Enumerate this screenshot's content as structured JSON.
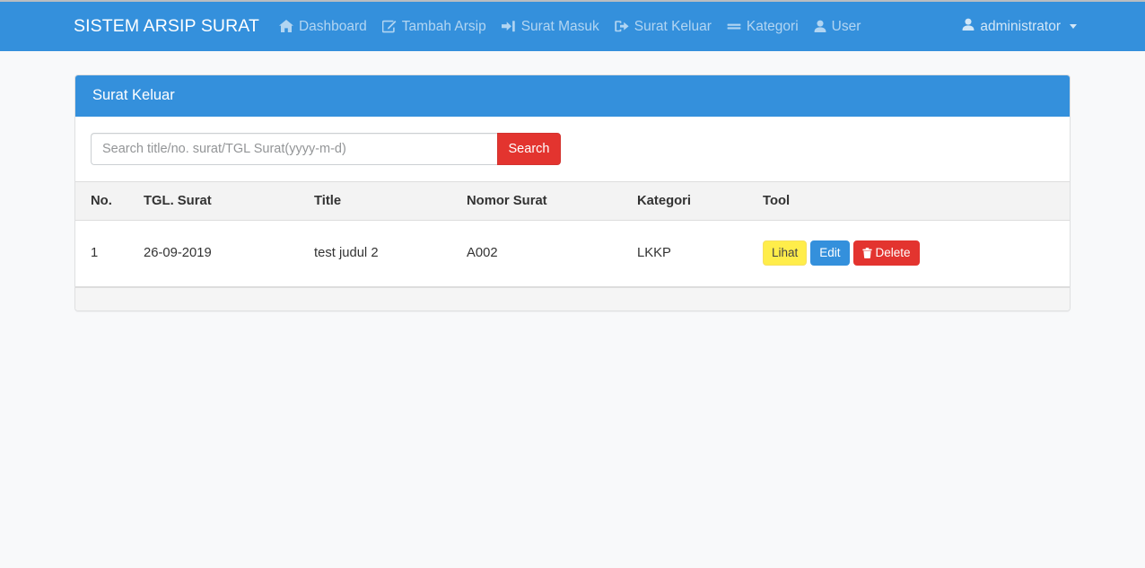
{
  "navbar": {
    "brand": "SISTEM ARSIP SURAT",
    "links": [
      {
        "label": "Dashboard",
        "icon": "home-icon"
      },
      {
        "label": "Tambah Arsip",
        "icon": "edit-square-icon"
      },
      {
        "label": "Surat Masuk",
        "icon": "sign-in-icon"
      },
      {
        "label": "Surat Keluar",
        "icon": "sign-out-icon"
      },
      {
        "label": "Kategori",
        "icon": "bars-icon"
      },
      {
        "label": "User",
        "icon": "user-icon"
      }
    ],
    "user": {
      "label": "administrator",
      "icon": "user-icon",
      "caret": "chevron-down-icon"
    },
    "bg_color": "#3490dc",
    "text_color": "#ffffff"
  },
  "panel": {
    "title": "Surat Keluar",
    "header_color": "#3490dc"
  },
  "search": {
    "value": "",
    "placeholder": "Search title/no. surat/TGL Surat(yyyy-m-d)",
    "button_label": "Search",
    "button_color": "#e3342f"
  },
  "table": {
    "columns": [
      "No.",
      "TGL. Surat",
      "Title",
      "Nomor Surat",
      "Kategori",
      "Tool"
    ],
    "rows": [
      {
        "no": "1",
        "tgl_surat": "26-09-2019",
        "title": "test judul 2",
        "nomor_surat": "A002",
        "kategori": "LKKP",
        "tools": {
          "lihat": "Lihat",
          "edit": "Edit",
          "delete": "Delete"
        }
      }
    ]
  },
  "colors": {
    "page_background": "#f8f9fa",
    "accent_blue": "#3490dc",
    "danger_red": "#e3342f",
    "warning_yellow": "#ffed4a",
    "table_header_bg": "#f3f3f3"
  }
}
